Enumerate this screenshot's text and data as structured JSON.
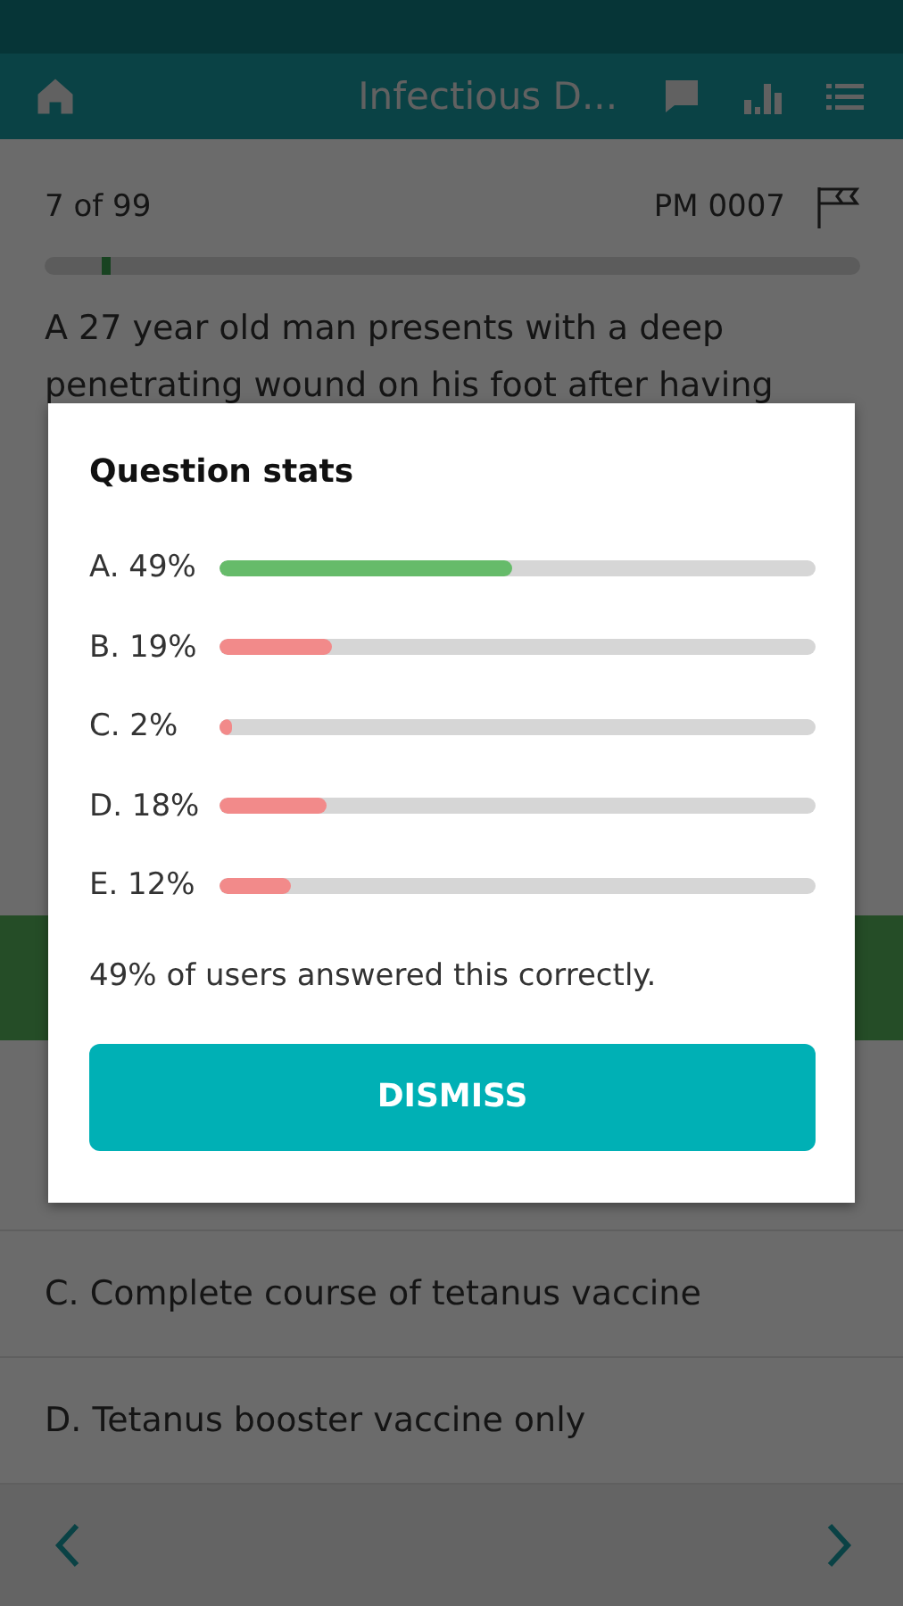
{
  "header": {
    "title": "Infectious D..."
  },
  "question_meta": {
    "position": "7 of 99",
    "code": "PM 0007",
    "progress": {
      "level": 0.07
    }
  },
  "question": {
    "lines": [
      "A 27 year old man presents with a deep",
      "penetrating wound on his foot after having"
    ]
  },
  "answers": [
    {
      "text": "C. Complete course of tetanus vaccine",
      "correct": false
    },
    {
      "text": "D. Tetanus booster vaccine only",
      "correct": false
    }
  ],
  "dialog": {
    "title": "Question stats",
    "stats": [
      {
        "label": "A. 49%",
        "level": 0.49,
        "correct": true
      },
      {
        "label": "B. 19%",
        "level": 0.19,
        "correct": false
      },
      {
        "label": "C. 2%",
        "level": 0.02,
        "correct": false
      },
      {
        "label": "D. 18%",
        "level": 0.18,
        "correct": false
      },
      {
        "label": "E. 12%",
        "level": 0.12,
        "correct": false
      }
    ],
    "summary": "49% of users answered this correctly.",
    "button": "DISMISS"
  }
}
